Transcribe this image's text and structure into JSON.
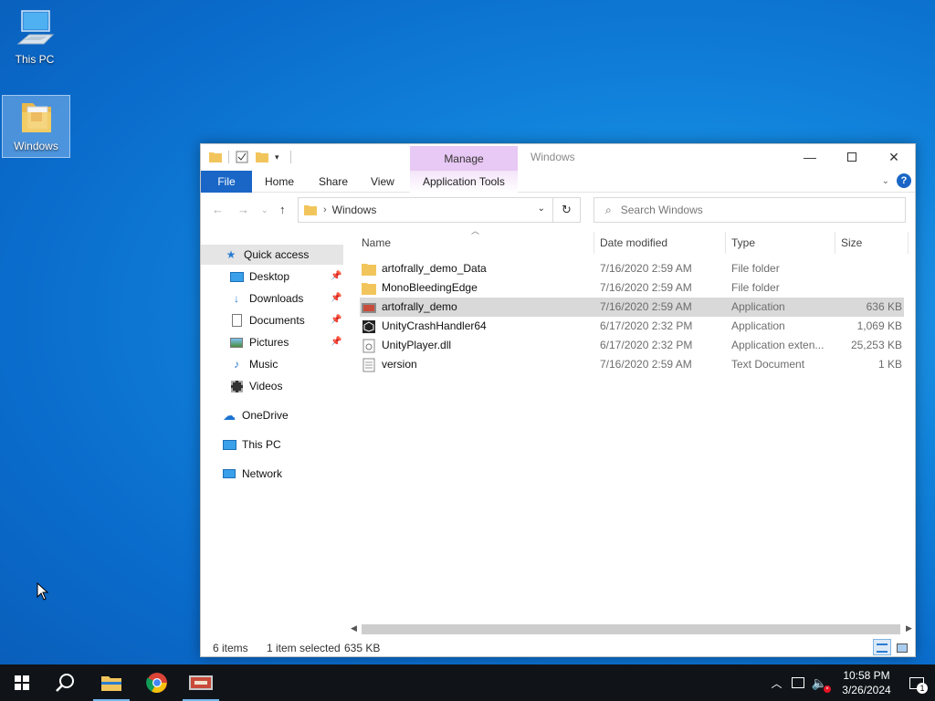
{
  "desktop": {
    "icons": [
      {
        "label": "This PC",
        "icon": "computer-icon"
      },
      {
        "label": "Windows",
        "icon": "folder-icon"
      }
    ]
  },
  "window": {
    "title": "Windows",
    "manage_label": "Manage",
    "ribbon_tabs": [
      "File",
      "Home",
      "Share",
      "View",
      "Application Tools"
    ],
    "address": {
      "crumb": "Windows"
    },
    "search": {
      "placeholder": "Search Windows"
    },
    "nav": {
      "quick_access": "Quick access",
      "items": [
        {
          "label": "Desktop",
          "pinned": true
        },
        {
          "label": "Downloads",
          "pinned": true
        },
        {
          "label": "Documents",
          "pinned": true
        },
        {
          "label": "Pictures",
          "pinned": true
        },
        {
          "label": "Music",
          "pinned": false
        },
        {
          "label": "Videos",
          "pinned": false
        }
      ],
      "onedrive": "OneDrive",
      "this_pc": "This PC",
      "network": "Network"
    },
    "columns": [
      "Name",
      "Date modified",
      "Type",
      "Size"
    ],
    "files": [
      {
        "name": "artofrally_demo_Data",
        "date": "7/16/2020 2:59 AM",
        "type": "File folder",
        "size": "",
        "icon": "folder-icon"
      },
      {
        "name": "MonoBleedingEdge",
        "date": "7/16/2020 2:59 AM",
        "type": "File folder",
        "size": "",
        "icon": "folder-icon"
      },
      {
        "name": "artofrally_demo",
        "date": "7/16/2020 2:59 AM",
        "type": "Application",
        "size": "636 KB",
        "icon": "app-icon",
        "selected": true
      },
      {
        "name": "UnityCrashHandler64",
        "date": "6/17/2020 2:32 PM",
        "type": "Application",
        "size": "1,069 KB",
        "icon": "unity-icon"
      },
      {
        "name": "UnityPlayer.dll",
        "date": "6/17/2020 2:32 PM",
        "type": "Application exten...",
        "size": "25,253 KB",
        "icon": "dll-icon"
      },
      {
        "name": "version",
        "date": "7/16/2020 2:59 AM",
        "type": "Text Document",
        "size": "1 KB",
        "icon": "text-file-icon"
      }
    ],
    "status": {
      "items": "6 items",
      "selected": "1 item selected",
      "size": "635 KB"
    }
  },
  "taskbar": {
    "time": "10:58 PM",
    "date": "3/26/2024",
    "notification_count": "1"
  },
  "colors": {
    "accent": "#1a66c6",
    "manage_tab": "#e8c8f4",
    "taskbar": "#101418"
  }
}
